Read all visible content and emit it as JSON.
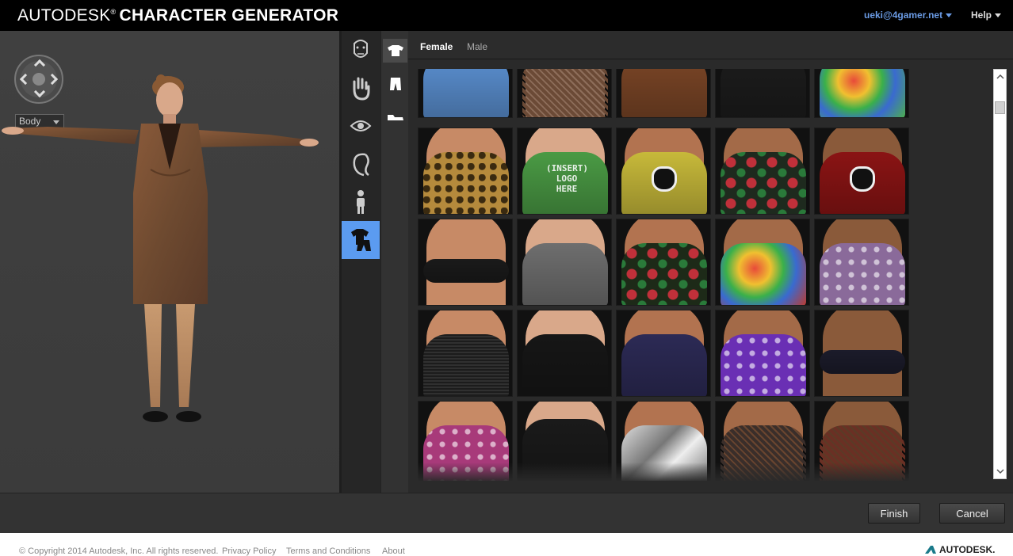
{
  "header": {
    "brand_light": "AUTODESK",
    "brand_reg": "®",
    "brand_bold": "CHARACTER GENERATOR",
    "user_email": "ueki@4gamer.net",
    "help_label": "Help"
  },
  "viewport": {
    "view_select": "Body"
  },
  "categories": [
    {
      "name": "face-icon",
      "active": false
    },
    {
      "name": "hand-icon",
      "active": false
    },
    {
      "name": "eye-icon",
      "active": false
    },
    {
      "name": "hair-icon",
      "active": false
    },
    {
      "name": "body-icon",
      "active": false
    },
    {
      "name": "clothing-icon",
      "active": true
    }
  ],
  "subcategories": [
    {
      "name": "top-icon",
      "active": true
    },
    {
      "name": "pants-icon",
      "active": false
    },
    {
      "name": "shoes-icon",
      "active": false
    }
  ],
  "gender_tabs": {
    "female": "Female",
    "male": "Male",
    "selected": "Female"
  },
  "tiles": [
    {
      "shirt": "#5a8fd0",
      "pattern": "plain"
    },
    {
      "shirt": "#6b4a36",
      "pattern": "lace"
    },
    {
      "shirt": "#7a4526",
      "pattern": "leather"
    },
    {
      "shirt": "#1c1c1c",
      "pattern": "leather"
    },
    {
      "shirt": "#4db04a",
      "pattern": "tiedye"
    },
    {
      "shirt": "#b58a3c",
      "pattern": "leopard"
    },
    {
      "shirt": "#4a9a44",
      "pattern": "insert-logo"
    },
    {
      "shirt": "#c7b93a",
      "pattern": "face-print"
    },
    {
      "shirt": "#1e2a1e",
      "pattern": "roses"
    },
    {
      "shirt": "#8a1414",
      "pattern": "face-print"
    },
    {
      "shirt": "#1a1a1a",
      "pattern": "bra"
    },
    {
      "shirt": "#6e6e6e",
      "pattern": "plain"
    },
    {
      "shirt": "#1d2a18",
      "pattern": "leaves"
    },
    {
      "shirt": "#c0392b",
      "pattern": "tiedye"
    },
    {
      "shirt": "#8a6a9a",
      "pattern": "paisley"
    },
    {
      "shirt": "#262626",
      "pattern": "knit"
    },
    {
      "shirt": "#161616",
      "pattern": "leather"
    },
    {
      "shirt": "#2c2a55",
      "pattern": "vest"
    },
    {
      "shirt": "#6a2fb4",
      "pattern": "floral"
    },
    {
      "shirt": "#1b1b2a",
      "pattern": "bra"
    },
    {
      "shirt": "#a83a7a",
      "pattern": "butterflies"
    },
    {
      "shirt": "#1a1a1a",
      "pattern": "corset"
    },
    {
      "shirt": "#9a9a9a",
      "pattern": "metallic"
    },
    {
      "shirt": "#3a2e2a",
      "pattern": "lace"
    },
    {
      "shirt": "#6a3024",
      "pattern": "lace"
    }
  ],
  "tile_texts": {
    "insert_logo": "(INSERT) LOGO HERE"
  },
  "actions": {
    "finish": "Finish",
    "cancel": "Cancel"
  },
  "footer": {
    "copyright": "© Copyright 2014 Autodesk, Inc. All rights reserved.",
    "privacy": "Privacy Policy",
    "terms": "Terms and Conditions",
    "about": "About",
    "logo": "AUTODESK."
  },
  "colors": {
    "accent": "#5b9bf0",
    "user_link": "#6b9ce6",
    "header_bg": "#000000"
  }
}
